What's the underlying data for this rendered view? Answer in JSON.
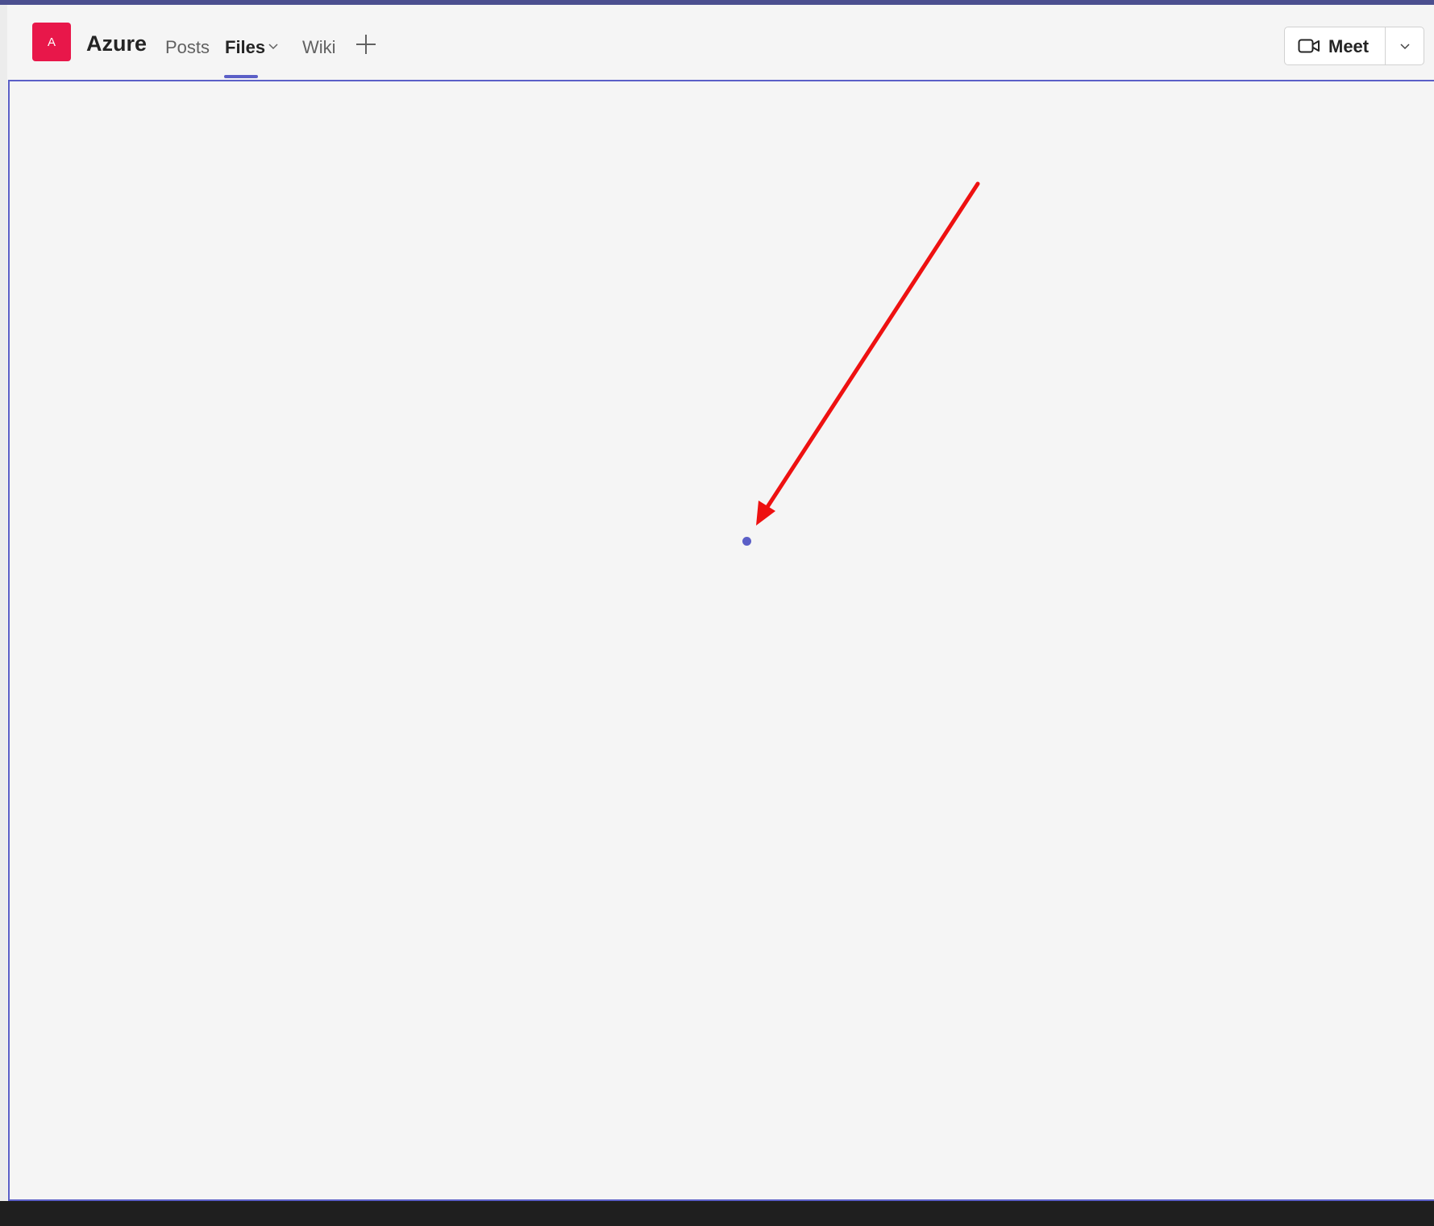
{
  "header": {
    "team_avatar_initial": "A",
    "team_name": "Azure",
    "tabs": [
      {
        "label": "Posts"
      },
      {
        "label": "Files"
      },
      {
        "label": "Wiki"
      }
    ],
    "active_tab": "Files",
    "add_tab_icon": "plus-icon",
    "meet": {
      "label": "Meet",
      "icon": "video-camera-icon",
      "dropdown_icon": "chevron-down-icon"
    }
  },
  "content": {
    "state": "loading",
    "loading_indicator_icon": "loading-dot-icon"
  },
  "annotation": {
    "type": "arrow",
    "color": "#ee1111"
  },
  "colors": {
    "accent": "#5b5fc7",
    "top_bar": "#4b4f8f",
    "avatar": "#e8174a",
    "background": "#f5f5f5"
  }
}
